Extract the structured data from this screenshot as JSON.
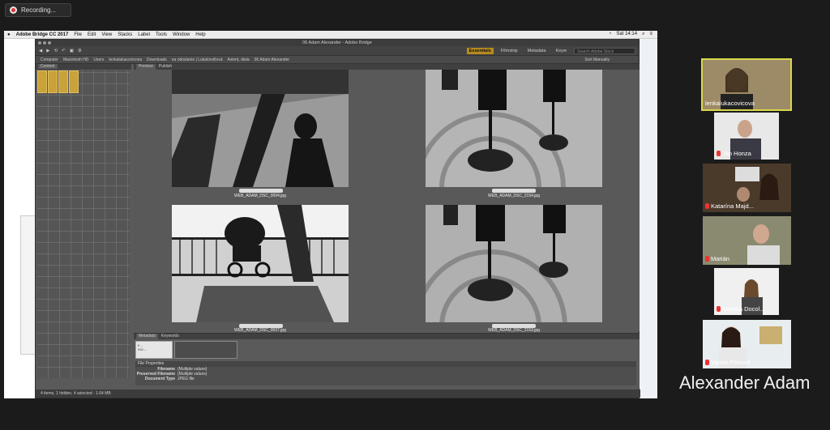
{
  "recording": {
    "label": "Recording..."
  },
  "mac_menu": {
    "app": "Adobe Bridge CC 2017",
    "items": [
      "File",
      "Edit",
      "View",
      "Stacks",
      "Label",
      "Tools",
      "Window",
      "Help"
    ],
    "time": "Sat 14:14"
  },
  "bridge": {
    "title": "06 Adam Alexander - Adobe Bridge",
    "workspaces": [
      "Essentials",
      "Filmstrip",
      "Metadata",
      "Keyw"
    ],
    "search_placeholder": "Search Adobe Stock",
    "path": [
      "Computer",
      "Macintosh HD",
      "Users",
      "lenkalukacovicova",
      "Downloads",
      "na odoslanie | Lukačovičová",
      "Avient, diela",
      "06 Adam Alexander"
    ],
    "sort": "Sort Manually",
    "left_tab": "Content",
    "center_tabs": [
      "Preview",
      "Publish"
    ],
    "photos": [
      {
        "caption": "WEB_ADAM_DSC_0004.jpg"
      },
      {
        "caption": "WEB_ADAM_DSC_2154.jpg"
      },
      {
        "caption": "WEB_ADAM_DSC_0037.jpg"
      },
      {
        "caption": "WEB_ADAM_DSC_2153.jpg"
      }
    ],
    "meta_tabs": [
      "Metadata",
      "Keywords"
    ],
    "meta_box": {
      "fstop": "f/ --",
      "iso": "ISO --"
    },
    "file_properties": {
      "header": "File Properties",
      "rows": [
        {
          "k": "Filename",
          "v": "(Multiple values)"
        },
        {
          "k": "Preserved Filename",
          "v": "(Multiple values)"
        },
        {
          "k": "Document Type",
          "v": "JPEG file"
        }
      ]
    },
    "status": "4 items, 1 hidden, 4 selected - 1.64 MB"
  },
  "participants": [
    {
      "name": "lenkalukacovicova",
      "muted": false,
      "active": true
    },
    {
      "name": "Ján Honza",
      "muted": true,
      "active": false
    },
    {
      "name": "Katarína Majd...",
      "muted": true,
      "active": false
    },
    {
      "name": "Marián",
      "muted": true,
      "active": false
    },
    {
      "name": "Martina Docol...",
      "muted": true,
      "active": false
    },
    {
      "name": "Vanda Pírková",
      "muted": true,
      "active": false
    }
  ],
  "active_speaker": "Alexander Adam"
}
